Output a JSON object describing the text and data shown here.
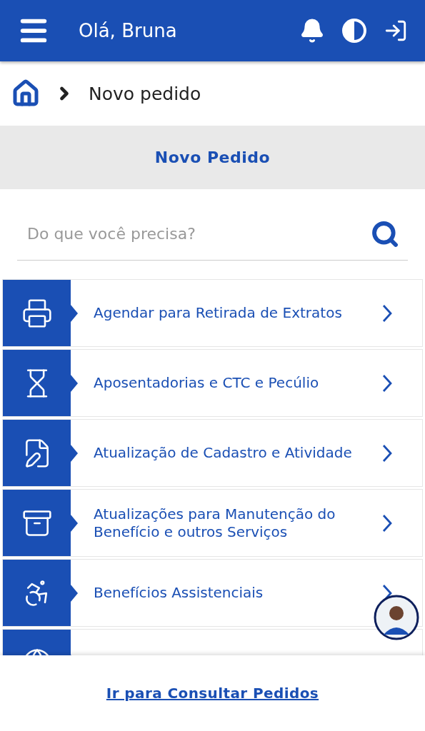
{
  "header": {
    "greeting": "Olá, Bruna"
  },
  "breadcrumb": {
    "current": "Novo pedido"
  },
  "section_title": "Novo Pedido",
  "search": {
    "placeholder": "Do que você precisa?"
  },
  "services": [
    {
      "label": "Agendar para Retirada de Extratos"
    },
    {
      "label": "Aposentadorias e CTC e Pecúlio"
    },
    {
      "label": "Atualização de Cadastro e Atividade"
    },
    {
      "label": "Atualizações para Manutenção do Benefício e outros Serviços"
    },
    {
      "label": "Benefícios Assistenciais"
    },
    {
      "cut_off": true
    }
  ],
  "footer_link": "Ir para Consultar Pedidos"
}
